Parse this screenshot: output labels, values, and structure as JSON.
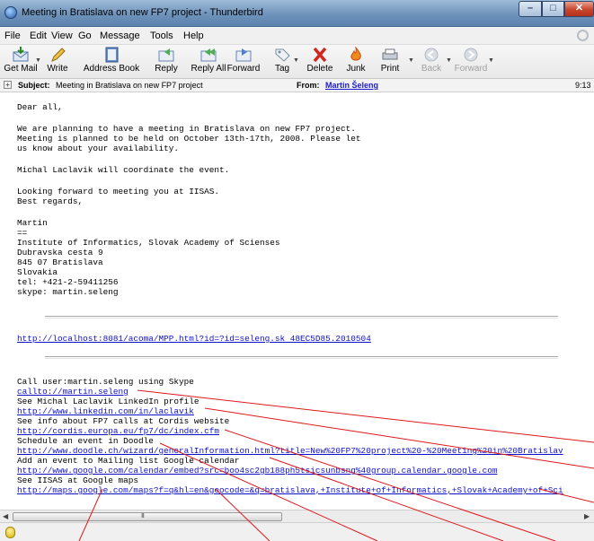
{
  "window": {
    "title": "Meeting in Bratislava on new FP7 project - Thunderbird"
  },
  "menu": [
    "File",
    "Edit",
    "View",
    "Go",
    "Message",
    "Tools",
    "Help"
  ],
  "toolbar": {
    "get_mail": "Get Mail",
    "write": "Write",
    "address_book": "Address Book",
    "reply": "Reply",
    "reply_all": "Reply All",
    "forward": "Forward",
    "tag": "Tag",
    "delete": "Delete",
    "junk": "Junk",
    "print": "Print",
    "back": "Back",
    "forward_nav": "Forward"
  },
  "header": {
    "subject_label": "Subject:",
    "subject": "Meeting in Bratislava on new FP7 project",
    "from_label": "From:",
    "from": "Martin Šeleng",
    "time": "9:13"
  },
  "body": {
    "greeting": "Dear all,",
    "para1": [
      "We are planning to have a meeting in Bratislava on new FP7 project.",
      "Meeting is planned to be held on October 13th-17th, 2008. Please let",
      "us know about your availability."
    ],
    "para2": "Michal Laclavik will coordinate the event.",
    "para3": [
      "Looking forward to meeting you at IISAS.",
      "Best regards,"
    ],
    "signature": [
      "Martin",
      "==",
      "Institute of Informatics, Slovak Academy of Scienses",
      "Dubravska cesta 9",
      "845 07 Bratislava",
      "Slovakia",
      "tel: +421-2-59411256",
      "skype: martin.seleng"
    ],
    "acoma_link": "http://localhost:8081/acoma/MPP.html?id=?id=seleng.sk 48EC5D85.2010504",
    "actions": [
      {
        "text": "Call user:martin.seleng using Skype",
        "link": "callto://martin.seleng"
      },
      {
        "text": "See Michal Laclavik LinkedIn profile",
        "link": "http://www.linkedin.com/in/laclavik"
      },
      {
        "text": "See info about FP7 calls at Cordis website",
        "link": "http://cordis.europa.eu/fp7/dc/index.cfm"
      },
      {
        "text": "Schedule an event in Doodle",
        "link": "http://www.doodle.ch/wizard/generalInformation.html?title=New%20FP7%20project%20-%20Meeting%20in%20Bratislav"
      },
      {
        "text": "Add an event to Mailing list Google calendar",
        "link": "http://www.google.com/calendar/embed?src=boo4sc2gb188ph5tsicsunbsng%40group.calendar.google.com"
      },
      {
        "text": "See IISAS at Google maps",
        "link": "http://maps.google.com/maps?f=q&hl=en&geocode=&q=bratislava,+Institute+of+Informatics,+Slovak+Academy+of+Sci"
      }
    ]
  },
  "scrollbar": {
    "grip": "III"
  },
  "colors": {
    "link": "#1010c8",
    "annotation": "#e0161b"
  }
}
